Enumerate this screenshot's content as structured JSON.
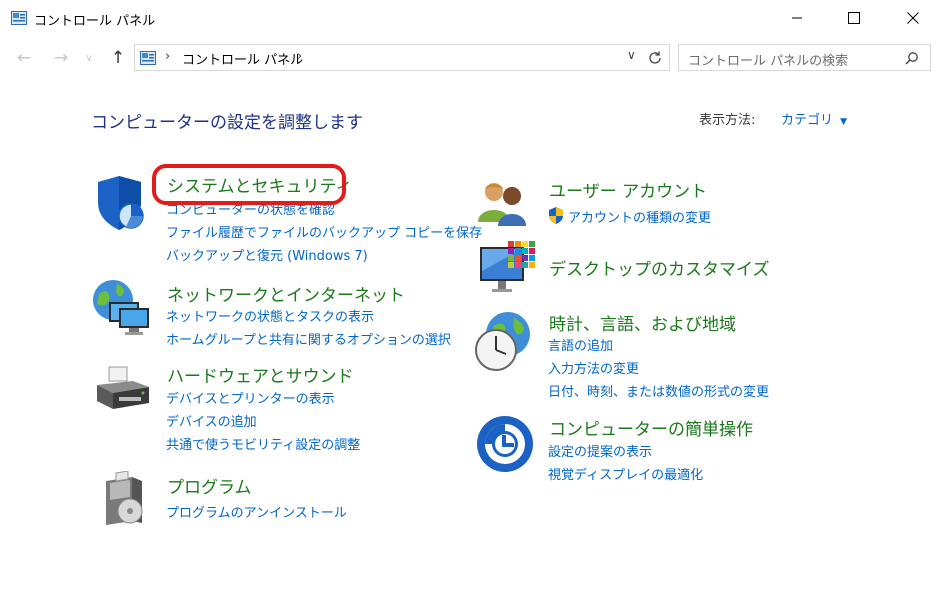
{
  "window": {
    "title": "コントロール パネル",
    "controls": {
      "minimize": "minimize-icon",
      "maximize": "maximize-icon",
      "close": "close-icon"
    }
  },
  "nav": {
    "address_path": "コントロール パネル",
    "search_placeholder": "コントロール パネルの検索"
  },
  "header": {
    "heading": "コンピューターの設定を調整します",
    "view_by_label": "表示方法:",
    "view_by_value": "カテゴリ"
  },
  "categories": {
    "system": {
      "title": "システムとセキュリティ",
      "links": [
        "コンピューターの状態を確認",
        "ファイル履歴でファイルのバックアップ コピーを保存",
        "バックアップと復元 (Windows 7)"
      ]
    },
    "network": {
      "title": "ネットワークとインターネット",
      "links": [
        "ネットワークの状態とタスクの表示",
        "ホームグループと共有に関するオプションの選択"
      ]
    },
    "hardware": {
      "title": "ハードウェアとサウンド",
      "links": [
        "デバイスとプリンターの表示",
        "デバイスの追加",
        "共通で使うモビリティ設定の調整"
      ]
    },
    "programs": {
      "title": "プログラム",
      "links": [
        "プログラムのアンインストール"
      ]
    },
    "users": {
      "title": "ユーザー アカウント",
      "links": [
        "アカウントの種類の変更"
      ]
    },
    "appearance": {
      "title": "デスクトップのカスタマイズ"
    },
    "clock": {
      "title": "時計、言語、および地域",
      "links": [
        "言語の追加",
        "入力方法の変更",
        "日付、時刻、または数値の形式の変更"
      ]
    },
    "ease": {
      "title": "コンピューターの簡単操作",
      "links": [
        "設定の提案の表示",
        "視覚ディスプレイの最適化"
      ]
    }
  },
  "colors": {
    "category_title": "#1a7a1a",
    "link": "#0066cc",
    "heading": "#1e3287",
    "highlight": "#e31b1b"
  }
}
